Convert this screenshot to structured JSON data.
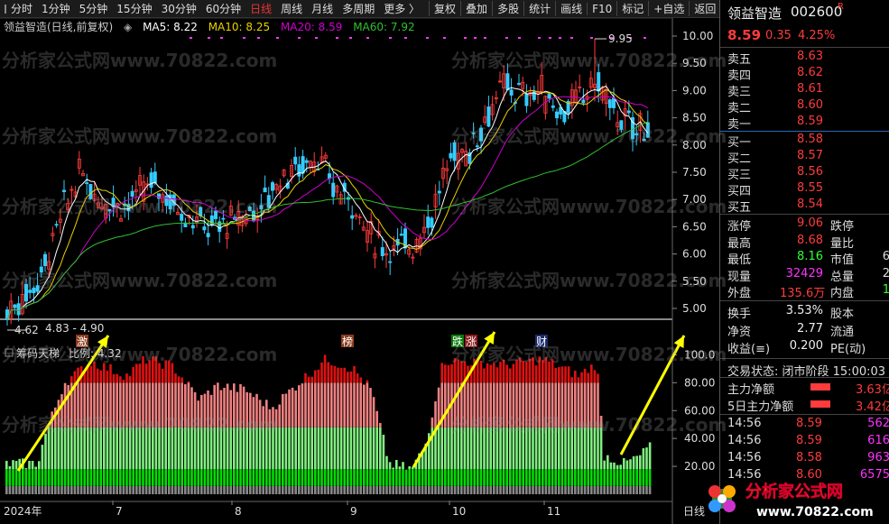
{
  "toolbar": {
    "periods": [
      "分时",
      "1分钟",
      "5分钟",
      "15分钟",
      "30分钟",
      "60分钟",
      "日线",
      "周线",
      "月线",
      "多周期",
      "更多 〉"
    ],
    "active_period": "日线",
    "buttons": [
      "复权",
      "叠加",
      "多股",
      "统计",
      "画线",
      "F10",
      "标记",
      "+自选",
      "返回"
    ]
  },
  "chart_header": {
    "title": "领益智造(日线,前复权)",
    "ma5": "MA5: 8.22",
    "ma10": "MA10: 8.25",
    "ma20": "MA20: 8.59",
    "ma60": "MA60: 7.92"
  },
  "price_axis": [
    "10.00",
    "9.50",
    "9.00",
    "8.50",
    "8.00",
    "7.50",
    "7.00",
    "6.50",
    "6.00",
    "5.50",
    "5.00"
  ],
  "annotations": {
    "high_mark": "9.95",
    "low_mark": "4.62",
    "range_text": "4.83 - 4.90",
    "event_tags": [
      "激",
      "榜",
      "跌",
      "涨",
      "财"
    ]
  },
  "indicator": {
    "title": "筹码天梯",
    "ratio": "比例: 4.32",
    "axis": [
      "100.0",
      "80.00",
      "60.00",
      "40.00",
      "20.00"
    ]
  },
  "date_axis": [
    "2024年",
    "7",
    "8",
    "9",
    "10",
    "11",
    "日线"
  ],
  "watermark": "分析家公式网www.70822.com",
  "logo": {
    "text": "分析家公式网",
    "url": "www.70822.com"
  },
  "side": {
    "stock_name": "领益智造",
    "code": "002600",
    "tag": "R",
    "price": "8.59",
    "change": "0.35",
    "pct": "4.25%",
    "asks": [
      {
        "label": "卖五",
        "price": "8.63"
      },
      {
        "label": "卖四",
        "price": "8.62"
      },
      {
        "label": "卖三",
        "price": "8.61"
      },
      {
        "label": "卖二",
        "price": "8.60"
      },
      {
        "label": "卖一",
        "price": "8.59"
      }
    ],
    "bids": [
      {
        "label": "买一",
        "price": "8.58"
      },
      {
        "label": "买二",
        "price": "8.57"
      },
      {
        "label": "买三",
        "price": "8.56"
      },
      {
        "label": "买四",
        "price": "8.55"
      },
      {
        "label": "买五",
        "price": "8.54"
      }
    ],
    "stats": [
      {
        "k": "涨停",
        "v": "9.06",
        "k2": "跌停",
        "v2": ""
      },
      {
        "k": "最高",
        "v": "8.68",
        "k2": "量比",
        "v2": ""
      },
      {
        "k": "最低",
        "v": "8.16",
        "k2": "市值",
        "v2": "6"
      },
      {
        "k": "现量",
        "v": "32429",
        "k2": "总量",
        "v2": "2"
      },
      {
        "k": "外盘",
        "v": "135.6万",
        "k2": "内盘",
        "v2": "1"
      }
    ],
    "stats2": [
      {
        "k": "换手",
        "v": "3.53%",
        "k2": "股本"
      },
      {
        "k": "净资",
        "v": "2.77",
        "k2": "流通"
      },
      {
        "k": "收益(≡)",
        "v": "0.200",
        "k2": "PE(动)"
      }
    ],
    "trade_status": "交易状态: 闭市阶段 15:00:03",
    "flows": [
      {
        "k": "主力净额",
        "v": "3.63亿"
      },
      {
        "k": "5日主力净额",
        "v": "3.42亿"
      }
    ],
    "ticks": [
      {
        "t": "14:56",
        "p": "8.59",
        "v": "562"
      },
      {
        "t": "14:56",
        "p": "8.59",
        "v": "616"
      },
      {
        "t": "14:56",
        "p": "8.58",
        "v": "963"
      },
      {
        "t": "14:56",
        "p": "8.60",
        "v": "6575"
      }
    ]
  },
  "colors": {
    "up": "#ff3b3b",
    "down": "#33ccff",
    "ma5": "#ffffff",
    "ma10": "#e8d000",
    "ma20": "#d000d0",
    "ma60": "#30c030",
    "arrow": "#ffff00"
  }
}
